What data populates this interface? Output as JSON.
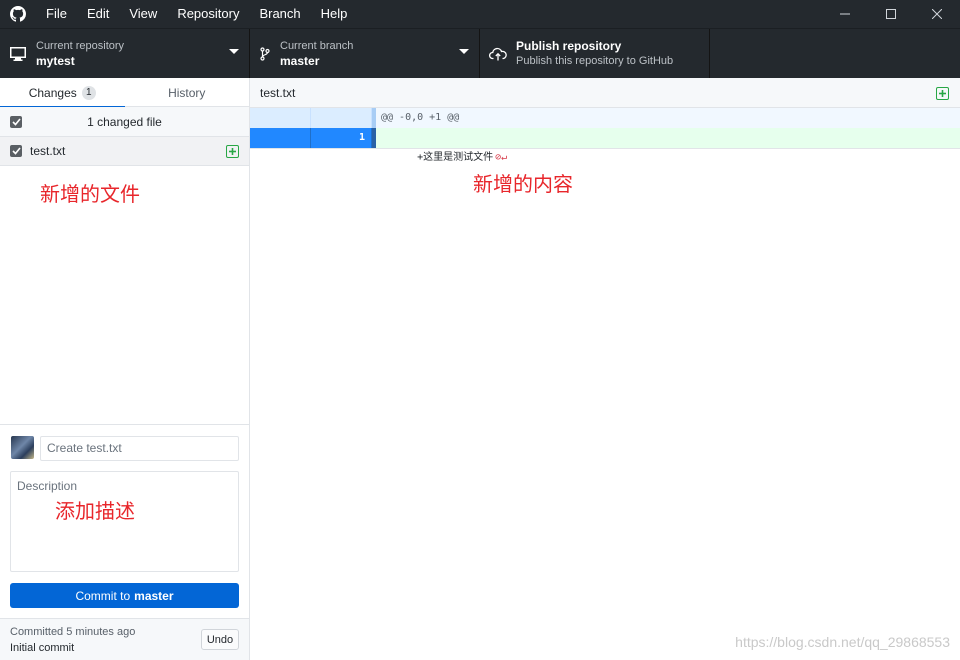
{
  "menu": [
    "File",
    "Edit",
    "View",
    "Repository",
    "Branch",
    "Help"
  ],
  "toolbar": {
    "repo_desc": "Current repository",
    "repo_name": "mytest",
    "branch_desc": "Current branch",
    "branch_name": "master",
    "publish_title": "Publish repository",
    "publish_desc": "Publish this repository to GitHub"
  },
  "tabs": {
    "changes": "Changes",
    "changes_count": "1",
    "history": "History"
  },
  "changes": {
    "summary": "1 changed file",
    "file": "test.txt"
  },
  "commit": {
    "summary_placeholder": "Create test.txt",
    "description_placeholder": "Description",
    "button_prefix": "Commit to",
    "button_branch": "master"
  },
  "last_commit": {
    "time": "Committed 5 minutes ago",
    "message": "Initial commit",
    "undo": "Undo"
  },
  "diff": {
    "file": "test.txt",
    "hunk_header": "@@ -0,0 +1 @@",
    "line_number": "1",
    "added_line": "+这里是测试文件"
  },
  "annotations": {
    "new_file": "新增的文件",
    "new_content": "新增的内容",
    "add_description": "添加描述"
  },
  "watermark": "https://blog.csdn.net/qq_29868553",
  "colors": {
    "titlebar": "#24292e",
    "accent": "#0366d6",
    "annotation": "#e8262b",
    "added": "#28a745"
  }
}
